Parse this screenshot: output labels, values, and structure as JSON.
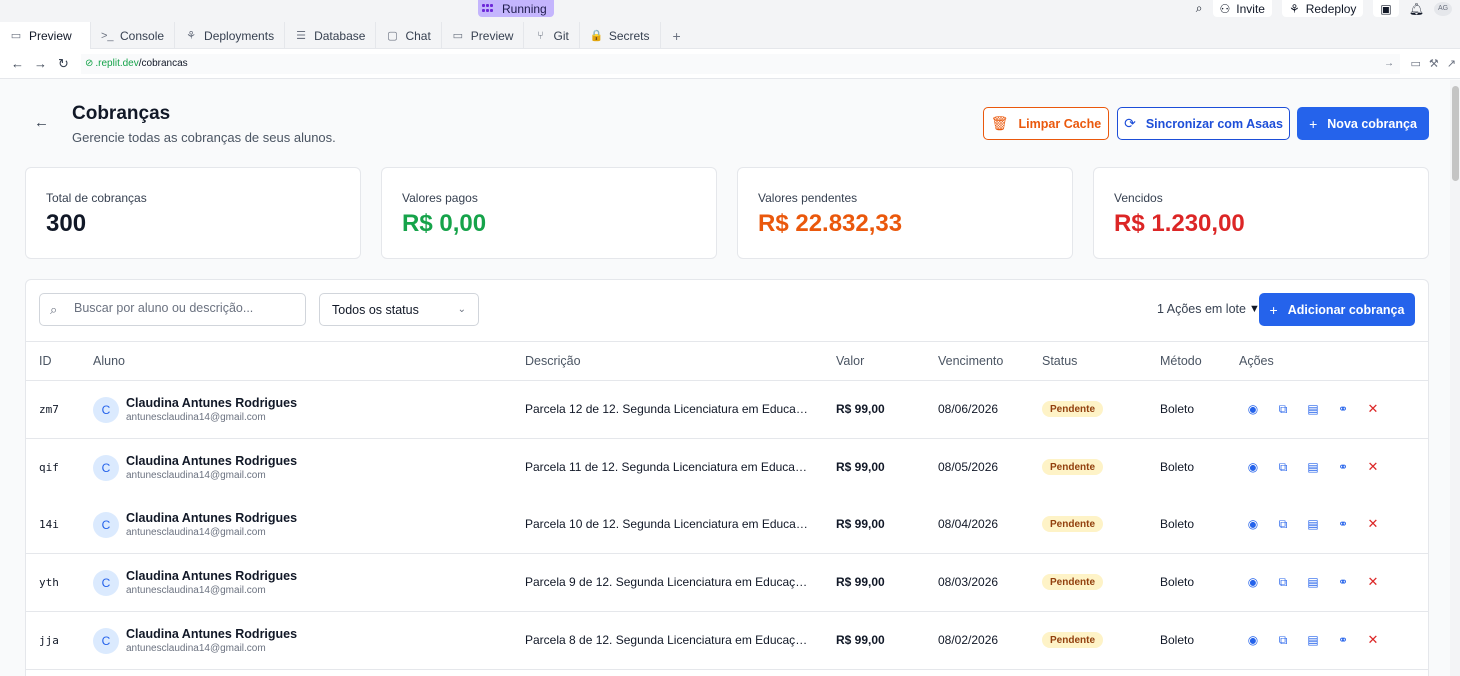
{
  "topbar": {
    "running": "Running",
    "invite": "Invite",
    "redeploy": "Redeploy",
    "avatar": "AG"
  },
  "tabs": [
    {
      "label": "Preview",
      "icon": "monitor-icon",
      "glyph": "▭"
    },
    {
      "label": "Console",
      "icon": "terminal-icon",
      "glyph": ">_"
    },
    {
      "label": "Deployments",
      "icon": "deploy-icon",
      "glyph": "⚘"
    },
    {
      "label": "Database",
      "icon": "database-icon",
      "glyph": "☰"
    },
    {
      "label": "Chat",
      "icon": "chat-icon",
      "glyph": "▢"
    },
    {
      "label": "Preview",
      "icon": "monitor-icon",
      "glyph": "▭"
    },
    {
      "label": "Git",
      "icon": "git-icon",
      "glyph": "⑂"
    },
    {
      "label": "Secrets",
      "icon": "lock-icon",
      "glyph": "🔒"
    }
  ],
  "address": {
    "domain": ".replit.dev",
    "path": "/cobrancas"
  },
  "header": {
    "title": "Cobranças",
    "subtitle": "Gerencie todas as cobranças de seus alunos."
  },
  "actions": {
    "clear_cache": "Limpar Cache",
    "sync": "Sincronizar com Asaas",
    "new": "Nova cobrança"
  },
  "stats": {
    "total_label": "Total de cobranças",
    "total_value": "300",
    "paid_label": "Valores pagos",
    "paid_value": "R$ 0,00",
    "pending_label": "Valores pendentes",
    "pending_value": "R$ 22.832,33",
    "overdue_label": "Vencidos",
    "overdue_value": "R$ 1.230,00"
  },
  "colors": {
    "paid": "#16a34a",
    "pending": "#ea580c",
    "overdue": "#dc2626",
    "primary": "#2563eb"
  },
  "filters": {
    "search_placeholder": "Buscar por aluno ou descrição...",
    "status_selected": "Todos os status",
    "batch": "1 Ações em lote",
    "add": "Adicionar cobrança"
  },
  "table": {
    "columns": [
      "ID",
      "Aluno",
      "Descrição",
      "Valor",
      "Vencimento",
      "Status",
      "Método",
      "Ações"
    ],
    "rows": [
      {
        "id": "zm7",
        "initial": "C",
        "name": "Claudina Antunes Rodrigues",
        "email": "antunesclaudina14@gmail.com",
        "desc": "Parcela 12 de 12. Segunda Licenciatura em Educação ...",
        "value": "R$ 99,00",
        "due": "08/06/2026",
        "status": "Pendente",
        "method": "Boleto"
      },
      {
        "id": "qif",
        "initial": "C",
        "name": "Claudina Antunes Rodrigues",
        "email": "antunesclaudina14@gmail.com",
        "desc": "Parcela 11 de 12. Segunda Licenciatura em Educação ...",
        "value": "R$ 99,00",
        "due": "08/05/2026",
        "status": "Pendente",
        "method": "Boleto"
      },
      {
        "id": "14i",
        "initial": "C",
        "name": "Claudina Antunes Rodrigues",
        "email": "antunesclaudina14@gmail.com",
        "desc": "Parcela 10 de 12. Segunda Licenciatura em Educação ...",
        "value": "R$ 99,00",
        "due": "08/04/2026",
        "status": "Pendente",
        "method": "Boleto"
      },
      {
        "id": "yth",
        "initial": "C",
        "name": "Claudina Antunes Rodrigues",
        "email": "antunesclaudina14@gmail.com",
        "desc": "Parcela 9 de 12. Segunda Licenciatura em Educação F...",
        "value": "R$ 99,00",
        "due": "08/03/2026",
        "status": "Pendente",
        "method": "Boleto"
      },
      {
        "id": "jja",
        "initial": "C",
        "name": "Claudina Antunes Rodrigues",
        "email": "antunesclaudina14@gmail.com",
        "desc": "Parcela 8 de 12. Segunda Licenciatura em Educação F...",
        "value": "R$ 99,00",
        "due": "08/02/2026",
        "status": "Pendente",
        "method": "Boleto"
      }
    ]
  }
}
